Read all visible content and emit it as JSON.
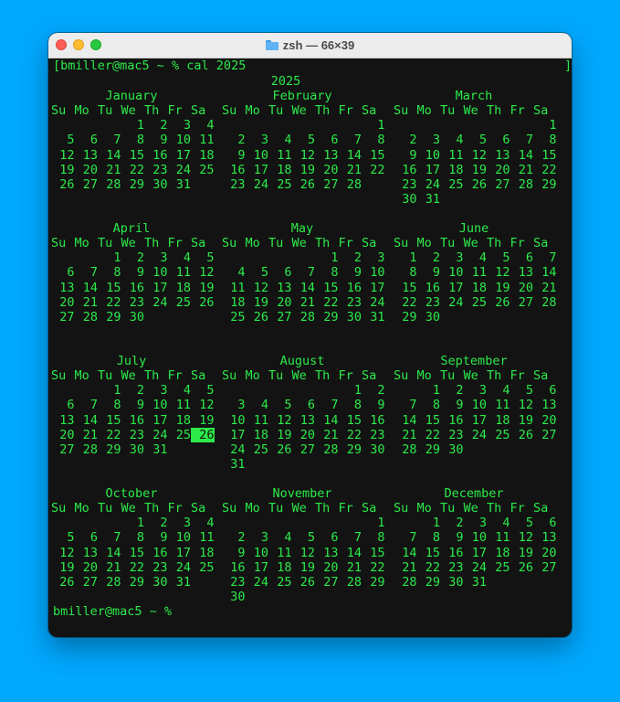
{
  "window": {
    "title": "zsh — 66×39",
    "title_icon": "folder-icon",
    "traffic_lights": [
      "close",
      "minimize",
      "zoom"
    ]
  },
  "terminal": {
    "command_line": "[bmiller@mac5 ~ % cal 2025",
    "right_bracket": "]",
    "year": "2025",
    "final_prompt": "bmiller@mac5 ~ % ",
    "foreground_color": "#2cea4a",
    "background_color": "#131313",
    "weekday_header": [
      "Su",
      "Mo",
      "Tu",
      "We",
      "Th",
      "Fr",
      "Sa"
    ],
    "today": {
      "month": "July",
      "day": 26
    },
    "months": [
      {
        "name": "January",
        "weeks": [
          [
            "",
            "",
            "",
            "1",
            "2",
            "3",
            "4"
          ],
          [
            "5",
            "6",
            "7",
            "8",
            "9",
            "10",
            "11"
          ],
          [
            "12",
            "13",
            "14",
            "15",
            "16",
            "17",
            "18"
          ],
          [
            "19",
            "20",
            "21",
            "22",
            "23",
            "24",
            "25"
          ],
          [
            "26",
            "27",
            "28",
            "29",
            "30",
            "31",
            ""
          ]
        ]
      },
      {
        "name": "February",
        "weeks": [
          [
            "",
            "",
            "",
            "",
            "",
            "",
            "1"
          ],
          [
            "2",
            "3",
            "4",
            "5",
            "6",
            "7",
            "8"
          ],
          [
            "9",
            "10",
            "11",
            "12",
            "13",
            "14",
            "15"
          ],
          [
            "16",
            "17",
            "18",
            "19",
            "20",
            "21",
            "22"
          ],
          [
            "23",
            "24",
            "25",
            "26",
            "27",
            "28",
            ""
          ]
        ]
      },
      {
        "name": "March",
        "weeks": [
          [
            "",
            "",
            "",
            "",
            "",
            "",
            "1"
          ],
          [
            "2",
            "3",
            "4",
            "5",
            "6",
            "7",
            "8"
          ],
          [
            "9",
            "10",
            "11",
            "12",
            "13",
            "14",
            "15"
          ],
          [
            "16",
            "17",
            "18",
            "19",
            "20",
            "21",
            "22"
          ],
          [
            "23",
            "24",
            "25",
            "26",
            "27",
            "28",
            "29"
          ],
          [
            "30",
            "31",
            "",
            "",
            "",
            "",
            ""
          ]
        ]
      },
      {
        "name": "April",
        "weeks": [
          [
            "",
            "",
            "1",
            "2",
            "3",
            "4",
            "5"
          ],
          [
            "6",
            "7",
            "8",
            "9",
            "10",
            "11",
            "12"
          ],
          [
            "13",
            "14",
            "15",
            "16",
            "17",
            "18",
            "19"
          ],
          [
            "20",
            "21",
            "22",
            "23",
            "24",
            "25",
            "26"
          ],
          [
            "27",
            "28",
            "29",
            "30",
            "",
            "",
            ""
          ]
        ]
      },
      {
        "name": "May",
        "weeks": [
          [
            "",
            "",
            "",
            "",
            "1",
            "2",
            "3"
          ],
          [
            "4",
            "5",
            "6",
            "7",
            "8",
            "9",
            "10"
          ],
          [
            "11",
            "12",
            "13",
            "14",
            "15",
            "16",
            "17"
          ],
          [
            "18",
            "19",
            "20",
            "21",
            "22",
            "23",
            "24"
          ],
          [
            "25",
            "26",
            "27",
            "28",
            "29",
            "30",
            "31"
          ]
        ]
      },
      {
        "name": "June",
        "weeks": [
          [
            "1",
            "2",
            "3",
            "4",
            "5",
            "6",
            "7"
          ],
          [
            "8",
            "9",
            "10",
            "11",
            "12",
            "13",
            "14"
          ],
          [
            "15",
            "16",
            "17",
            "18",
            "19",
            "20",
            "21"
          ],
          [
            "22",
            "23",
            "24",
            "25",
            "26",
            "27",
            "28"
          ],
          [
            "29",
            "30",
            "",
            "",
            "",
            "",
            ""
          ]
        ]
      },
      {
        "name": "July",
        "weeks": [
          [
            "",
            "",
            "1",
            "2",
            "3",
            "4",
            "5"
          ],
          [
            "6",
            "7",
            "8",
            "9",
            "10",
            "11",
            "12"
          ],
          [
            "13",
            "14",
            "15",
            "16",
            "17",
            "18",
            "19"
          ],
          [
            "20",
            "21",
            "22",
            "23",
            "24",
            "25",
            "26"
          ],
          [
            "27",
            "28",
            "29",
            "30",
            "31",
            "",
            ""
          ]
        ]
      },
      {
        "name": "August",
        "weeks": [
          [
            "",
            "",
            "",
            "",
            "",
            "1",
            "2"
          ],
          [
            "3",
            "4",
            "5",
            "6",
            "7",
            "8",
            "9"
          ],
          [
            "10",
            "11",
            "12",
            "13",
            "14",
            "15",
            "16"
          ],
          [
            "17",
            "18",
            "19",
            "20",
            "21",
            "22",
            "23"
          ],
          [
            "24",
            "25",
            "26",
            "27",
            "28",
            "29",
            "30"
          ],
          [
            "31",
            "",
            "",
            "",
            "",
            "",
            ""
          ]
        ]
      },
      {
        "name": "September",
        "weeks": [
          [
            "",
            "1",
            "2",
            "3",
            "4",
            "5",
            "6"
          ],
          [
            "7",
            "8",
            "9",
            "10",
            "11",
            "12",
            "13"
          ],
          [
            "14",
            "15",
            "16",
            "17",
            "18",
            "19",
            "20"
          ],
          [
            "21",
            "22",
            "23",
            "24",
            "25",
            "26",
            "27"
          ],
          [
            "28",
            "29",
            "30",
            "",
            "",
            "",
            ""
          ]
        ]
      },
      {
        "name": "October",
        "weeks": [
          [
            "",
            "",
            "",
            "1",
            "2",
            "3",
            "4"
          ],
          [
            "5",
            "6",
            "7",
            "8",
            "9",
            "10",
            "11"
          ],
          [
            "12",
            "13",
            "14",
            "15",
            "16",
            "17",
            "18"
          ],
          [
            "19",
            "20",
            "21",
            "22",
            "23",
            "24",
            "25"
          ],
          [
            "26",
            "27",
            "28",
            "29",
            "30",
            "31",
            ""
          ]
        ]
      },
      {
        "name": "November",
        "weeks": [
          [
            "",
            "",
            "",
            "",
            "",
            "",
            "1"
          ],
          [
            "2",
            "3",
            "4",
            "5",
            "6",
            "7",
            "8"
          ],
          [
            "9",
            "10",
            "11",
            "12",
            "13",
            "14",
            "15"
          ],
          [
            "16",
            "17",
            "18",
            "19",
            "20",
            "21",
            "22"
          ],
          [
            "23",
            "24",
            "25",
            "26",
            "27",
            "28",
            "29"
          ],
          [
            "30",
            "",
            "",
            "",
            "",
            "",
            ""
          ]
        ]
      },
      {
        "name": "December",
        "weeks": [
          [
            "",
            "1",
            "2",
            "3",
            "4",
            "5",
            "6"
          ],
          [
            "7",
            "8",
            "9",
            "10",
            "11",
            "12",
            "13"
          ],
          [
            "14",
            "15",
            "16",
            "17",
            "18",
            "19",
            "20"
          ],
          [
            "21",
            "22",
            "23",
            "24",
            "25",
            "26",
            "27"
          ],
          [
            "28",
            "29",
            "30",
            "31",
            "",
            "",
            ""
          ]
        ]
      }
    ]
  }
}
